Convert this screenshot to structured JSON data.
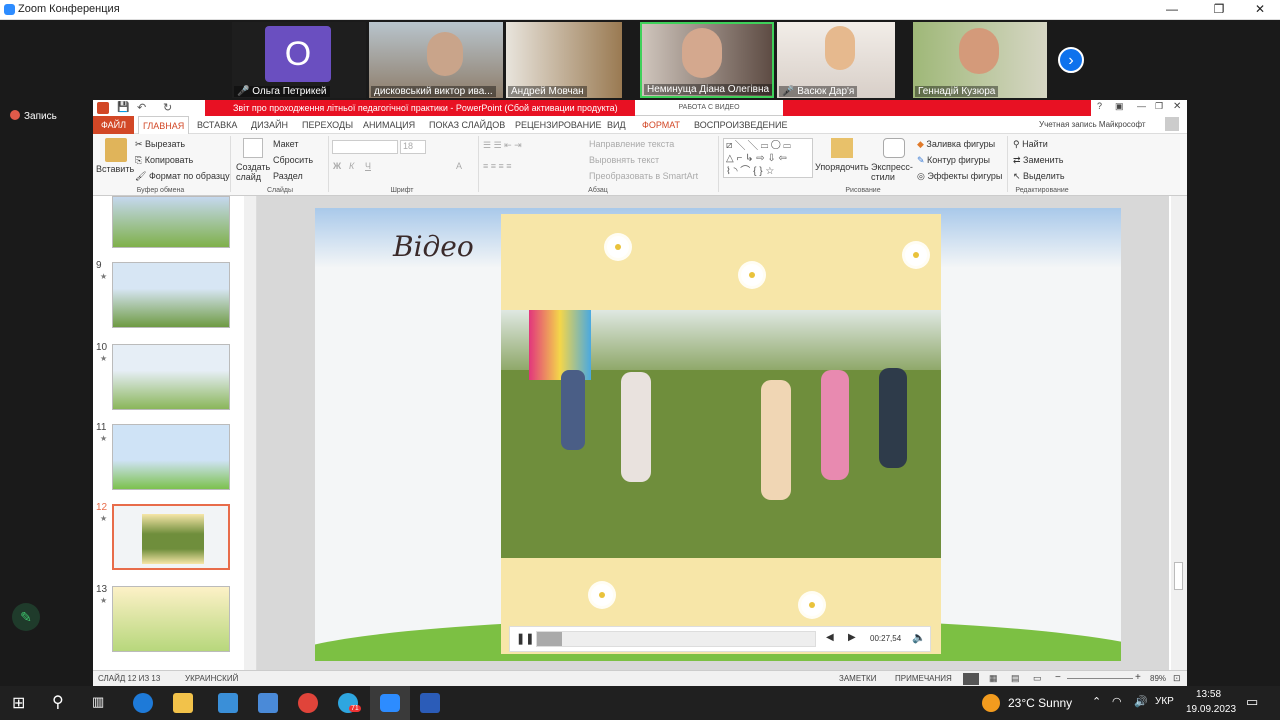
{
  "app": {
    "title": "Zoom Конференция"
  },
  "participants": [
    {
      "name": "Ольга Петрикей",
      "initial": "O",
      "muted": true
    },
    {
      "name": "дисковський виктор ива...",
      "muted": false
    },
    {
      "name": "Андрей Мовчан",
      "muted": false
    },
    {
      "name": "Неминуща Діана Олегівна",
      "muted": false
    },
    {
      "name": "Васюк Дар'я",
      "muted": true
    },
    {
      "name": "Геннадій Кузюра",
      "muted": true
    }
  ],
  "zoom": {
    "record_label": "Запись"
  },
  "ppt": {
    "title": "Звіт про проходження літньої педагогічної практики - PowerPoint (Сбой активации продукта)",
    "context_tab": "РАБОТА С ВИДЕО",
    "account": "Учетная запись Майкрософт",
    "tabs": [
      "ФАЙЛ",
      "ГЛАВНАЯ",
      "ВСТАВКА",
      "ДИЗАЙН",
      "ПЕРЕХОДЫ",
      "АНИМАЦИЯ",
      "ПОКАЗ СЛАЙДОВ",
      "РЕЦЕНЗИРОВАНИЕ",
      "ВИД",
      "ФОРМАТ",
      "ВОСПРОИЗВЕДЕНИЕ"
    ],
    "ribbon": {
      "paste": "Вставить",
      "cut": "Вырезать",
      "copy": "Копировать",
      "format_painter": "Формат по образцу",
      "clipboard_group": "Буфер обмена",
      "new_slide": "Создать слайд",
      "layout": "Макет",
      "reset": "Сбросить",
      "section": "Раздел",
      "slides_group": "Слайды",
      "font_size": "18",
      "font_group": "Шрифт",
      "text_direction": "Направление текста",
      "align_text": "Выровнять текст",
      "convert_smartart": "Преобразовать в SmartArt",
      "paragraph_group": "Абзац",
      "arrange": "Упорядочить",
      "quick_styles": "Экспресс-стили",
      "shape_fill": "Заливка фигуры",
      "shape_outline": "Контур фигуры",
      "shape_effects": "Эффекты фигуры",
      "drawing_group": "Рисование",
      "find": "Найти",
      "replace": "Заменить",
      "select": "Выделить",
      "editing_group": "Редактирование"
    },
    "thumbnails": [
      {
        "num": "9"
      },
      {
        "num": "10"
      },
      {
        "num": "11"
      },
      {
        "num": "12"
      },
      {
        "num": "13"
      }
    ],
    "slide": {
      "title": "Відео",
      "video_time": "00:27,54",
      "video_progress": 0.09
    },
    "status": {
      "slide": "СЛАЙД 12 ИЗ 13",
      "language": "УКРАИНСКИЙ",
      "notes": "ЗАМЕТКИ",
      "comments": "ПРИМЕЧАНИЯ",
      "zoom": "89%"
    }
  },
  "taskbar": {
    "weather": "23°C  Sunny",
    "lang": "УКР",
    "time": "13:58",
    "date": "19.09.2023",
    "telegram_badge": "71"
  }
}
